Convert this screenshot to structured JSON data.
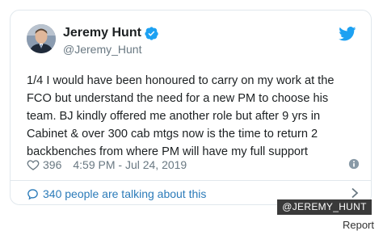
{
  "tweet": {
    "author": {
      "display_name": "Jeremy Hunt",
      "handle": "@Jeremy_Hunt",
      "verified": true
    },
    "text_lines": [
      "1/4 I would have been honoured to carry on my work at the",
      "FCO but understand the need for a new PM to choose his",
      "team. BJ kindly offered me another role but after 9 yrs in",
      "Cabinet & over 300 cab mtgs now is the time to return 2",
      "backbenches from where PM will have my full support"
    ],
    "like_count": "396",
    "timestamp": "4:59 PM - Jul 24, 2019",
    "talking_text": "340 people are talking about this"
  },
  "photo_credit": "@JEREMY_HUNT",
  "report_label": "Report",
  "icons": {
    "brand": "twitter-bird-icon",
    "verified": "verified-badge-icon",
    "like": "heart-icon",
    "info": "info-icon",
    "reply": "speech-bubble-icon",
    "chevron": "chevron-right-icon"
  },
  "colors": {
    "twitter_blue": "#1da1f2",
    "link_blue": "#2b7bb9",
    "text": "#1c2022",
    "secondary_text": "#697882",
    "border": "#e1e8ed"
  }
}
